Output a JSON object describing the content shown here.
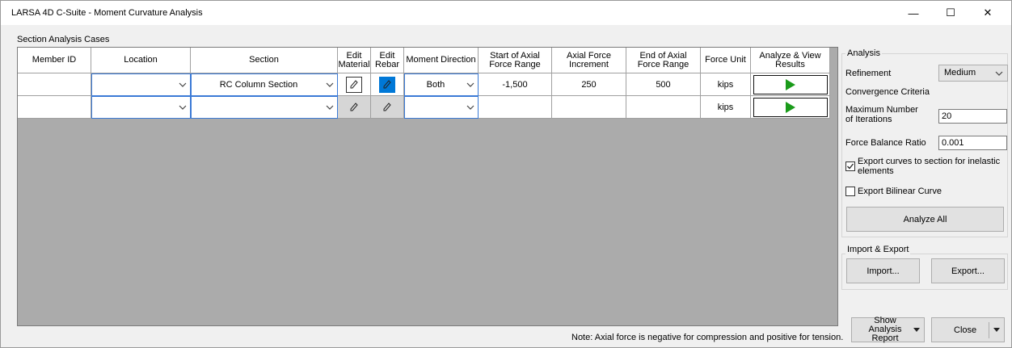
{
  "window": {
    "title": "LARSA 4D C-Suite - Moment Curvature Analysis",
    "controls": {
      "minimize": "—",
      "maximize": "☐",
      "close": "✕"
    }
  },
  "section_label": "Section Analysis Cases",
  "table": {
    "headers": {
      "member_id": "Member ID",
      "location": "Location",
      "section": "Section",
      "edit_material": "Edit Material",
      "edit_rebar": "Edit Rebar",
      "moment_direction": "Moment Direction",
      "start_axial": "Start of Axial Force Range",
      "axial_increment": "Axial Force Increment",
      "end_axial": "End of Axial Force Range",
      "force_unit": "Force Unit",
      "analyze": "Analyze & View Results"
    },
    "rows": [
      {
        "member_id": "",
        "location": "",
        "section": "RC Column Section",
        "moment_direction": "Both",
        "start_axial": "-1,500",
        "axial_increment": "250",
        "end_axial": "500",
        "force_unit": "kips"
      },
      {
        "member_id": "",
        "location": "",
        "section": "",
        "moment_direction": "",
        "start_axial": "",
        "axial_increment": "",
        "end_axial": "",
        "force_unit": "kips"
      }
    ]
  },
  "note": "Note: Axial force is negative for compression and positive for tension.",
  "analysis": {
    "title": "Analysis",
    "refinement_label": "Refinement",
    "refinement_value": "Medium",
    "convergence_label": "Convergence Criteria",
    "max_iterations_label": "Maximum Number of Iterations",
    "max_iterations_value": "20",
    "force_balance_label": "Force Balance Ratio",
    "force_balance_value": "0.001",
    "export_curves_label": "Export curves to section for inelastic elements",
    "export_curves_checked": true,
    "export_bilinear_label": "Export Bilinear Curve",
    "export_bilinear_checked": false,
    "analyze_all_label": "Analyze All"
  },
  "import_export": {
    "title": "Import & Export",
    "import_label": "Import...",
    "export_label": "Export..."
  },
  "footer_buttons": {
    "show_report_label": "Show Analysis Report",
    "close_label": "Close"
  },
  "colors": {
    "accent": "#0078d7",
    "run_arrow": "#1a9b1a",
    "grid_bg": "#ababab"
  }
}
